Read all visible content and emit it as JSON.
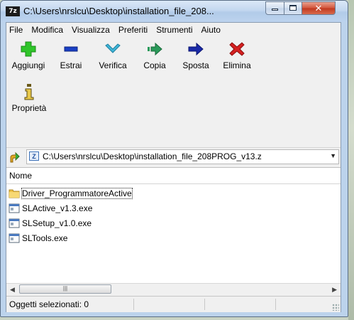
{
  "window": {
    "app_icon_text": "7z",
    "title": "C:\\Users\\nrslcu\\Desktop\\installation_file_208..."
  },
  "menu": [
    "File",
    "Modifica",
    "Visualizza",
    "Preferiti",
    "Strumenti",
    "Aiuto"
  ],
  "toolbar": {
    "add": "Aggiungi",
    "extract": "Estrai",
    "test": "Verifica",
    "copy": "Copia",
    "move": "Sposta",
    "delete": "Elimina",
    "info": "Proprietà"
  },
  "address": {
    "path": "C:\\Users\\nrslcu\\Desktop\\installation_file_208PROG_v13.z"
  },
  "filelist": {
    "column_name": "Nome",
    "items": [
      {
        "name": "Driver_ProgrammatoreActive",
        "icon": "folder-icon"
      },
      {
        "name": "SLActive_v1.3.exe",
        "icon": "exe-icon"
      },
      {
        "name": "SLSetup_v1.0.exe",
        "icon": "exe-icon"
      },
      {
        "name": "SLTools.exe",
        "icon": "exe-icon"
      }
    ]
  },
  "status": {
    "selected": "Oggetti selezionati: 0"
  },
  "colors": {
    "add": "#2fc52a",
    "extract": "#1a3fc4",
    "test": "#3fb6d8",
    "copy": "#2a9a5a",
    "move": "#1a2aa8",
    "delete": "#d42020",
    "folder": "#f0c24a"
  }
}
